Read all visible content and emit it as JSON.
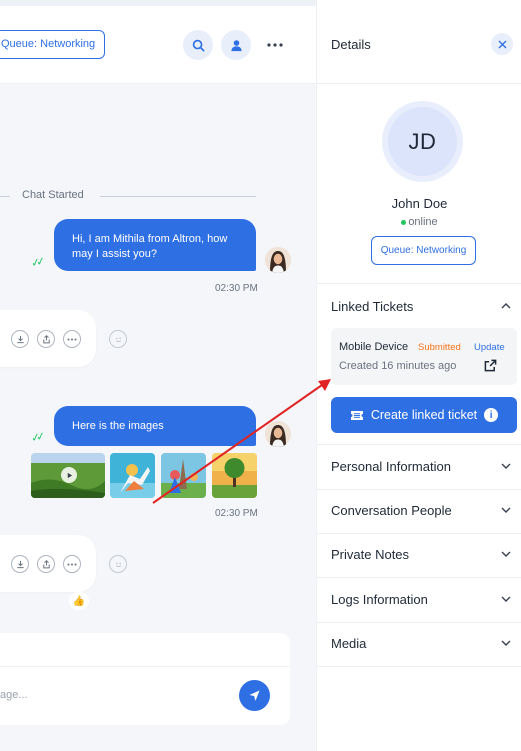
{
  "header": {
    "queue_label": "Queue: Networking",
    "icons": {
      "search": "search-icon",
      "user": "user-icon",
      "more": "more-horizontal-icon"
    }
  },
  "chat": {
    "divider_text": "Chat Started",
    "messages": [
      {
        "text": "Hi, I am Mithila from Altron, how may I assist you?",
        "time": "02:30 PM"
      },
      {
        "text": "Here is the images",
        "time": "02:30 PM"
      }
    ],
    "composer_placeholder": "age...",
    "reaction": "👍",
    "colors": {
      "accent": "#2f6fe4",
      "read_ticks": "#22c55e"
    }
  },
  "details": {
    "title": "Details",
    "profile": {
      "initials": "JD",
      "name": "John Doe",
      "status": "online",
      "queue": "Queue: Networking"
    },
    "linked_tickets": {
      "label": "Linked Tickets",
      "ticket": {
        "name": "Mobile Device",
        "status": "Submitted",
        "action": "Update",
        "created": "Created 16 minutes ago"
      },
      "create_button": "Create linked ticket"
    },
    "sections": [
      {
        "label": "Personal Information"
      },
      {
        "label": "Conversation People"
      },
      {
        "label": "Private Notes"
      },
      {
        "label": "Logs Information"
      },
      {
        "label": "Media"
      }
    ],
    "colors": {
      "status_submitted": "#f97316",
      "online": "#22c55e"
    }
  }
}
